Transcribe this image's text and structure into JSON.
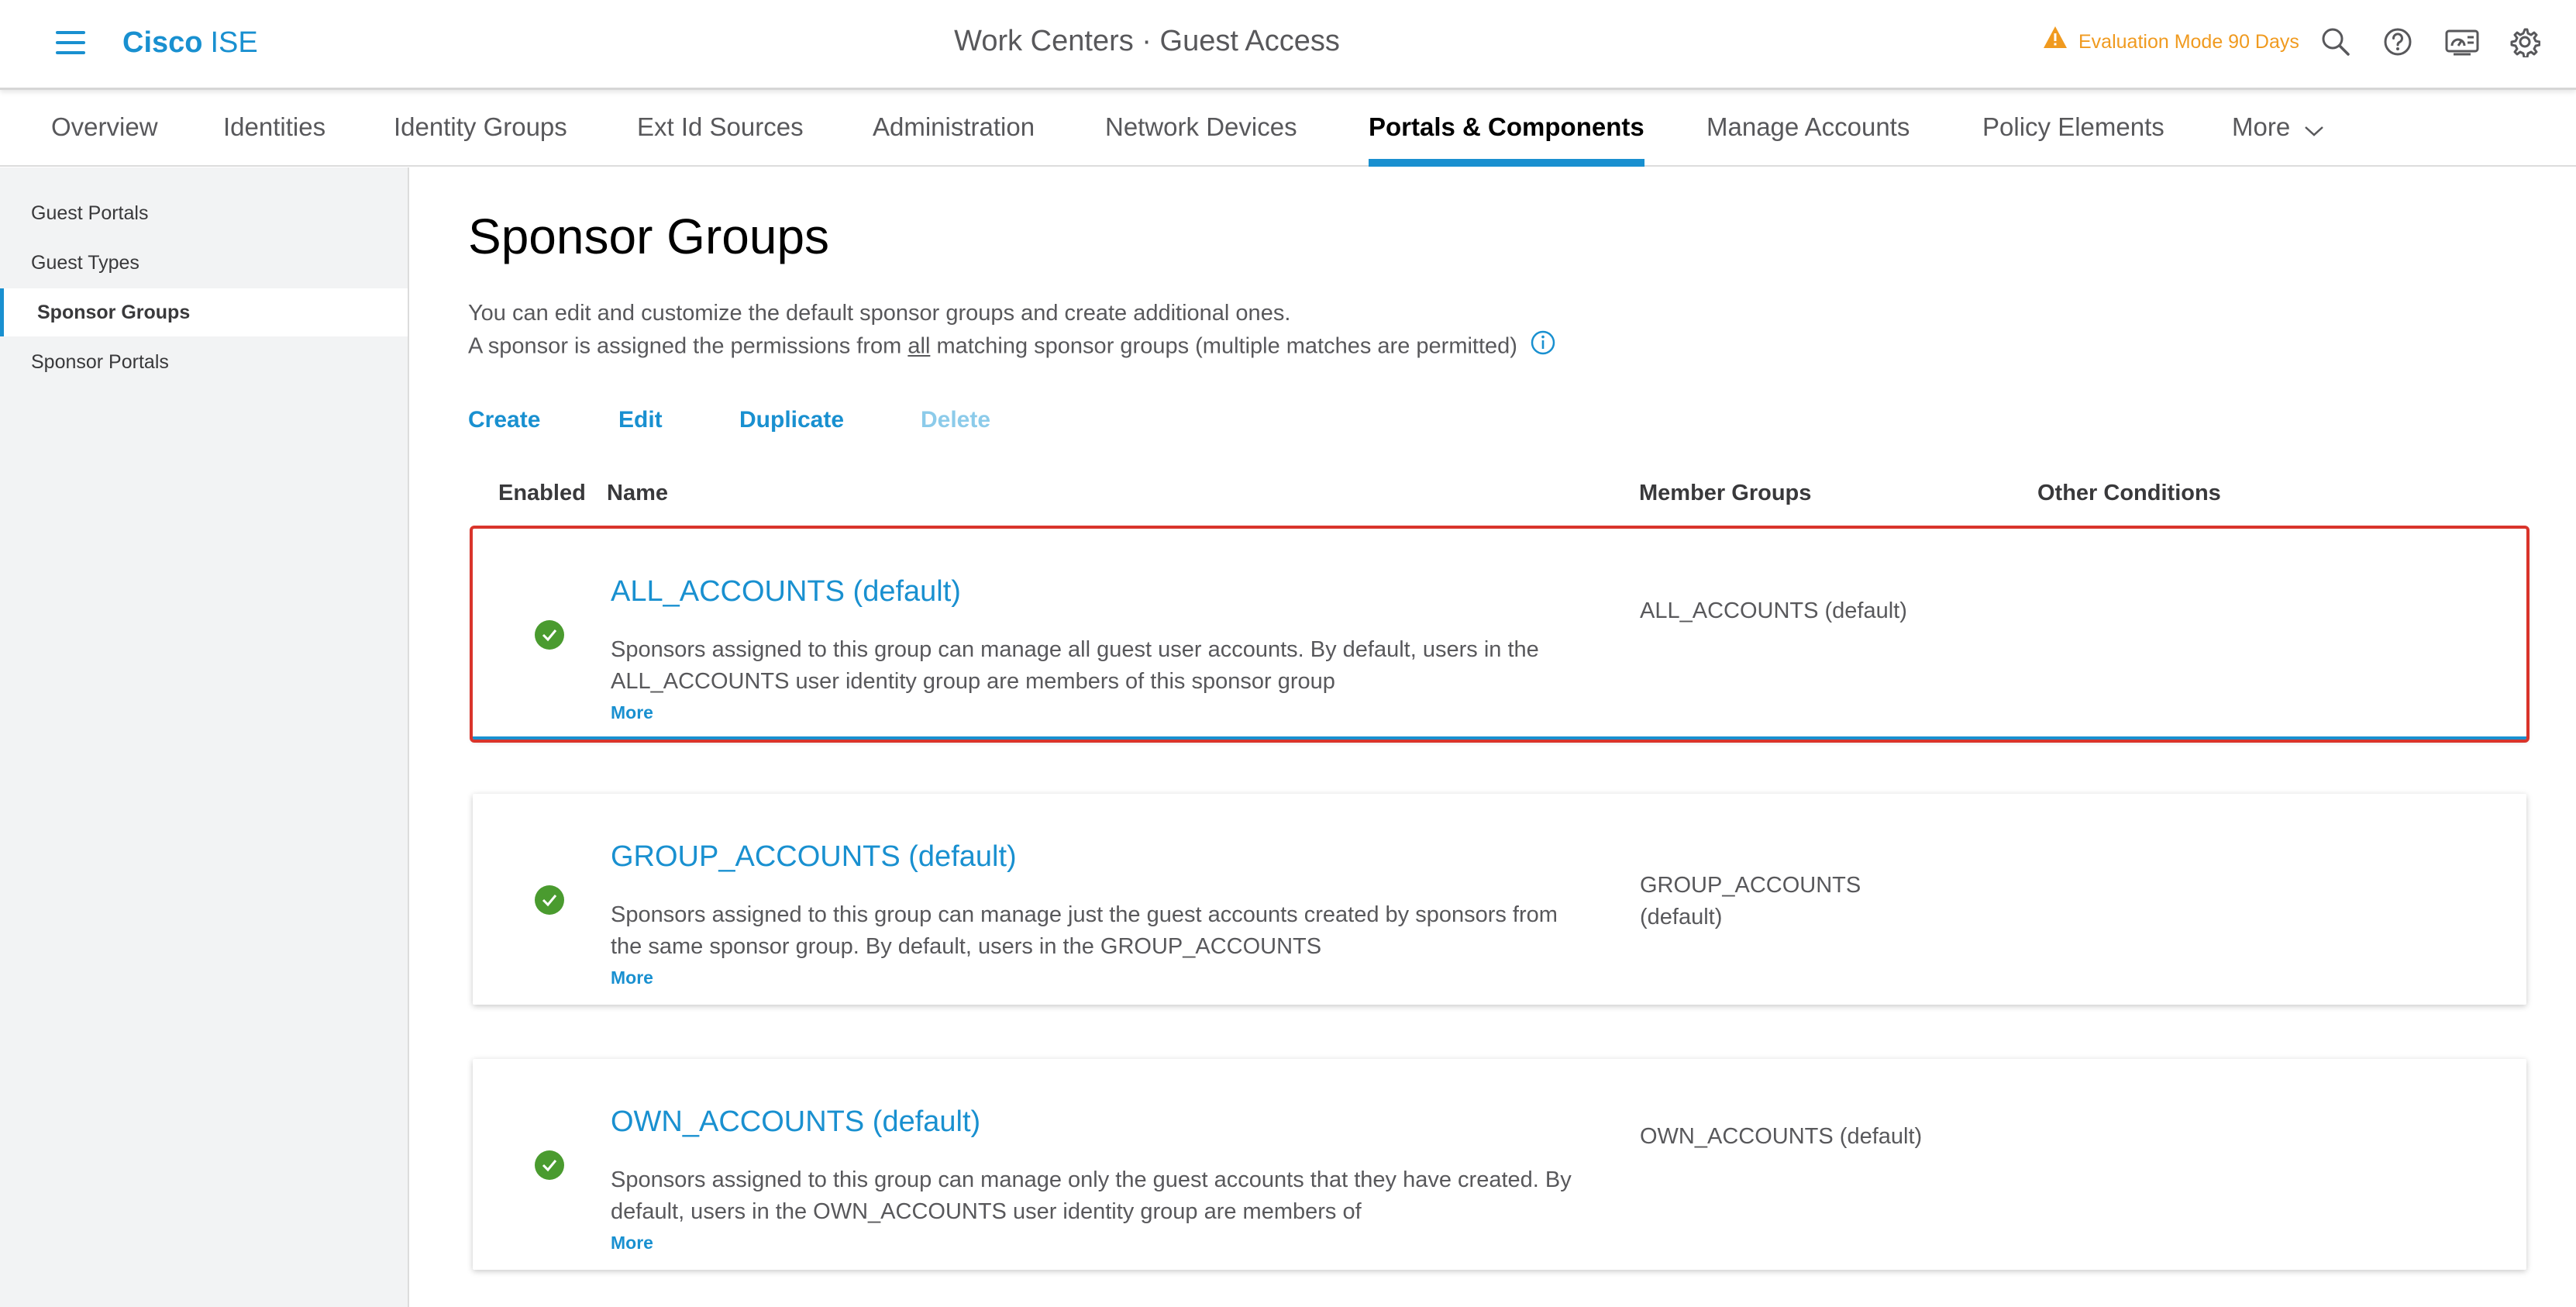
{
  "header": {
    "brand_bold": "Cisco",
    "brand_light": "ISE",
    "title": "Work Centers · Guest Access",
    "evaluation": "Evaluation Mode 90 Days",
    "icons": [
      "warning-icon",
      "search-icon",
      "help-icon",
      "dashboard-icon",
      "gear-icon"
    ]
  },
  "tabs": [
    {
      "label": "Overview"
    },
    {
      "label": "Identities"
    },
    {
      "label": "Identity Groups"
    },
    {
      "label": "Ext Id Sources"
    },
    {
      "label": "Administration"
    },
    {
      "label": "Network Devices"
    },
    {
      "label": "Portals & Components",
      "active": true
    },
    {
      "label": "Manage Accounts"
    },
    {
      "label": "Policy Elements"
    },
    {
      "label": "More"
    }
  ],
  "sidebar": {
    "items": [
      {
        "label": "Guest Portals"
      },
      {
        "label": "Guest Types"
      },
      {
        "label": "Sponsor Groups",
        "active": true
      },
      {
        "label": "Sponsor Portals"
      }
    ]
  },
  "main": {
    "title": "Sponsor Groups",
    "desc_line1": "You can edit and customize the default sponsor groups and create additional ones.",
    "desc_line2_a": "A sponsor is assigned the permissions from ",
    "desc_line2_u": "all",
    "desc_line2_b": " matching sponsor groups (multiple matches are permitted)",
    "actions": {
      "create": "Create",
      "edit": "Edit",
      "duplicate": "Duplicate",
      "delete": "Delete"
    },
    "columns": {
      "enabled": "Enabled",
      "name": "Name",
      "member_groups": "Member Groups",
      "other_conditions": "Other Conditions"
    },
    "rows": [
      {
        "name": "ALL_ACCOUNTS (default)",
        "description": "Sponsors assigned to this group can manage all guest user accounts. By default, users in the ALL_ACCOUNTS user identity group are members of this sponsor group",
        "more": "More",
        "member_groups": "ALL_ACCOUNTS (default)",
        "enabled": true,
        "selected": true
      },
      {
        "name": "GROUP_ACCOUNTS (default)",
        "description": "Sponsors assigned to this group can manage just the guest accounts created by sponsors from the same sponsor group. By default, users in the GROUP_ACCOUNTS",
        "more": "More",
        "member_groups": "GROUP_ACCOUNTS (default)",
        "enabled": true,
        "selected": false
      },
      {
        "name": "OWN_ACCOUNTS (default)",
        "description": "Sponsors assigned to this group can manage only the guest accounts that they have created. By default, users in the OWN_ACCOUNTS user identity group are members of",
        "more": "More",
        "member_groups": "OWN_ACCOUNTS (default)",
        "enabled": true,
        "selected": false
      }
    ]
  },
  "colors": {
    "accent": "#1990d0",
    "warning": "#f09a1f",
    "enabled": "#4a9b2f",
    "selection_outline": "#d9342b"
  }
}
